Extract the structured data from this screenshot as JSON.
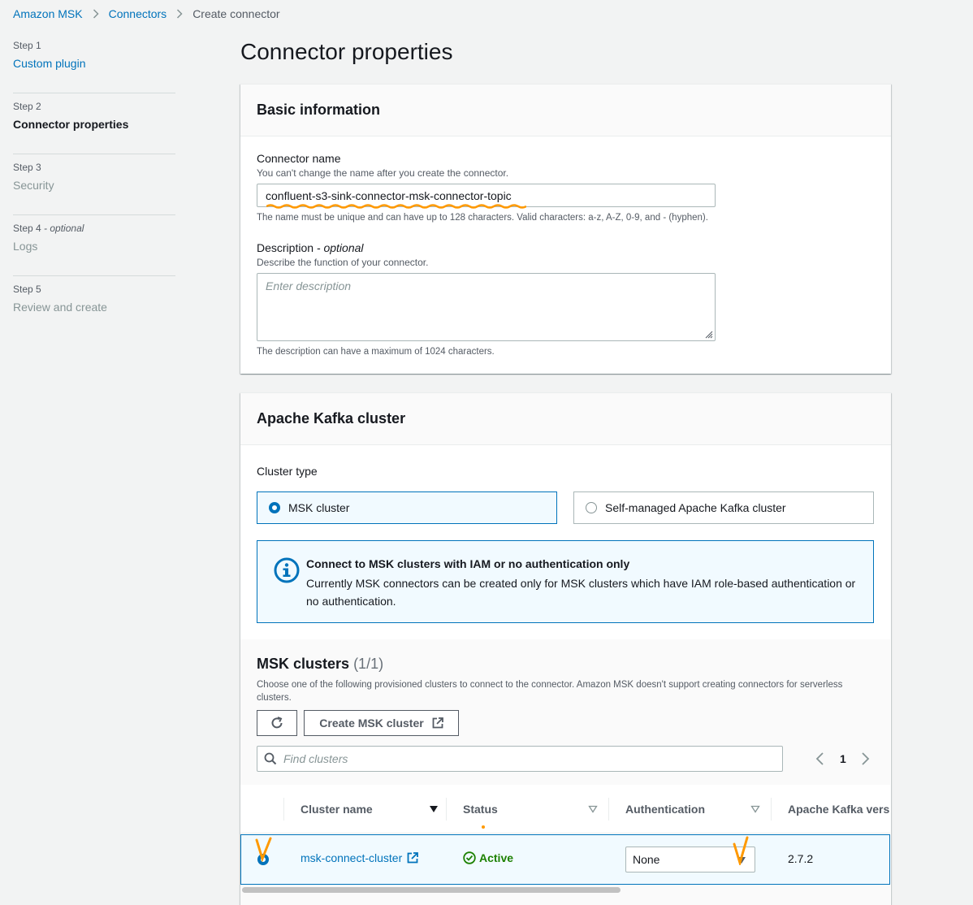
{
  "breadcrumb": {
    "items": [
      "Amazon MSK",
      "Connectors"
    ],
    "current": "Create connector"
  },
  "steps": [
    {
      "num": "Step 1",
      "optional": "",
      "title": "Custom plugin",
      "state": "link"
    },
    {
      "num": "Step 2",
      "optional": "",
      "title": "Connector properties",
      "state": "active"
    },
    {
      "num": "Step 3",
      "optional": "",
      "title": "Security",
      "state": "disabled"
    },
    {
      "num": "Step 4",
      "optional": " - optional",
      "title": "Logs",
      "state": "disabled"
    },
    {
      "num": "Step 5",
      "optional": "",
      "title": "Review and create",
      "state": "disabled"
    }
  ],
  "page_title": "Connector properties",
  "basic": {
    "header": "Basic information",
    "name_label": "Connector name",
    "name_desc": "You can't change the name after you create the connector.",
    "name_value": "confluent-s3-sink-connector-msk-connector-topic",
    "name_hint": "The name must be unique and can have up to 128 characters. Valid characters: a-z, A-Z, 0-9, and - (hyphen).",
    "desc_label": "Description",
    "desc_optional": " - optional",
    "desc_desc": "Describe the function of your connector.",
    "desc_placeholder": "Enter description",
    "desc_hint": "The description can have a maximum of 1024 characters."
  },
  "kafka": {
    "header": "Apache Kafka cluster",
    "cluster_type_label": "Cluster type",
    "options": [
      "MSK cluster",
      "Self-managed Apache Kafka cluster"
    ],
    "selected_option": 0,
    "info_title": "Connect to MSK clusters with IAM or no authentication only",
    "info_text": "Currently MSK connectors can be created only for MSK clusters which have IAM role-based authentication or no authentication.",
    "clusters_title": "MSK clusters",
    "clusters_count": "(1/1)",
    "clusters_desc": "Choose one of the following provisioned clusters to connect to the connector. Amazon MSK doesn't support creating connectors for serverless clusters.",
    "create_button": "Create MSK cluster",
    "search_placeholder": "Find clusters",
    "page_number": "1",
    "columns": [
      "Cluster name",
      "Status",
      "Authentication",
      "Apache Kafka versi"
    ],
    "row": {
      "name": "msk-connect-cluster",
      "status": "Active",
      "auth": "None",
      "version": "2.7.2"
    }
  },
  "colors": {
    "link": "#0073bb",
    "success": "#1d8102",
    "annotation": "#ff9900"
  }
}
